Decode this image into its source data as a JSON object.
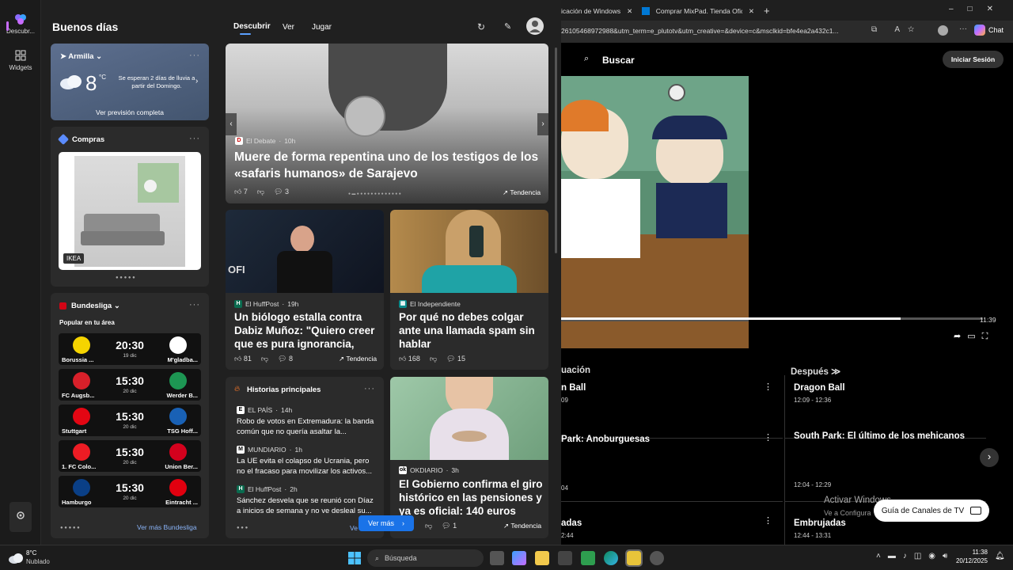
{
  "rail": {
    "discover_label": "Descubr...",
    "widgets_label": "Widgets"
  },
  "header": {
    "greeting": "Buenos días",
    "tabs": [
      "Descubrir",
      "Ver",
      "Jugar"
    ]
  },
  "weather": {
    "location": "Armilla",
    "temp": "8",
    "unit": "°C",
    "forecast_note": "Se esperan 2 días de lluvia a partir del Domingo.",
    "link": "Ver previsión completa"
  },
  "shopping": {
    "title": "Compras",
    "brand": "IKEA"
  },
  "bundesliga": {
    "title": "Bundesliga",
    "subtitle": "Popular en tu área",
    "matches": [
      {
        "home": "Borussia ...",
        "away": "M'gladba...",
        "time": "20:30",
        "date": "19 dic",
        "home_color": "#f5d400",
        "away_color": "#ffffff"
      },
      {
        "home": "FC Augsb...",
        "away": "Werder B...",
        "time": "15:30",
        "date": "20 dic",
        "home_color": "#d8202a",
        "away_color": "#1d9653"
      },
      {
        "home": "Stuttgart",
        "away": "TSG Hoff...",
        "time": "15:30",
        "date": "20 dic",
        "home_color": "#e30613",
        "away_color": "#1961b5"
      },
      {
        "home": "1. FC Colo...",
        "away": "Union Ber...",
        "time": "15:30",
        "date": "20 dic",
        "home_color": "#ed1c24",
        "away_color": "#d4011d"
      },
      {
        "home": "Hamburgo",
        "away": "Eintracht ...",
        "time": "15:30",
        "date": "20 dic",
        "home_color": "#0a3f86",
        "away_color": "#e1000f"
      }
    ],
    "more": "Ver más Bundesliga"
  },
  "hero": {
    "source": "El Debate",
    "age": "10h",
    "title": "Muere de forma repentina uno de los testigos de los «safaris humanos» de Sarajevo",
    "likes": "7",
    "comments": "3",
    "trend": "Tendencia"
  },
  "card_huff": {
    "source": "El HuffPost",
    "age": "19h",
    "title": "Un biólogo estalla contra Dabiz Muñoz: \"Quiero creer que es pura ignorancia, qu...",
    "likes": "81",
    "comments": "8",
    "trend": "Tendencia"
  },
  "card_indep": {
    "source": "El Independiente",
    "title": "Por qué no debes colgar ante una llamada spam sin hablar",
    "likes": "168",
    "comments": "15"
  },
  "top_stories": {
    "title": "Historias principales",
    "items": [
      {
        "source": "EL PAÍS",
        "age": "14h",
        "text": "Robo de votos en Extremadura: la banda común que no quería asaltar la..."
      },
      {
        "source": "MUNDIARIO",
        "age": "1h",
        "text": "La UE evita el colapso de Ucrania, pero no el fracaso para movilizar los activos..."
      },
      {
        "source": "El HuffPost",
        "age": "2h",
        "text": "Sánchez desvela que se reunió con Díaz a inicios de semana y no ve desleal su..."
      }
    ],
    "more_short": "Ve"
  },
  "card_okdiario": {
    "source": "OKDIARIO",
    "age": "3h",
    "title": "El Gobierno confirma el giro histórico en las pensiones y ya es oficial: 140 euros más...",
    "comments": "1",
    "trend": "Tendencia"
  },
  "see_more": "Ver más",
  "browser": {
    "tabs": [
      "icación de Windows",
      "Comprar MixPad. Tienda Oficial de"
    ],
    "url": "26105468972988&utm_term=e_plutotv&utm_creative=&device=c&msclkid=bfe4ea2a432c1...",
    "chat": "Chat",
    "search": "Buscar",
    "login": "Iniciar Sesión",
    "video_time": "11:39",
    "now_label": "uación",
    "next_label": "Después",
    "now_programs": [
      {
        "title": "n Ball",
        "time": "09"
      },
      {
        "title": "Park: Anoburguesas",
        "time": "04"
      },
      {
        "title": "adas",
        "time": "2:44"
      }
    ],
    "next_programs": [
      {
        "title": "Dragon Ball",
        "time": "12:09 - 12:36"
      },
      {
        "title": "South Park: El último de los mehicanos",
        "time": "12:04 - 12:29"
      },
      {
        "title": "Embrujadas",
        "time": "12:44 - 13:31"
      }
    ],
    "activate_title": "Activar Windows",
    "activate_sub": "Ve a Configura",
    "guide_button": "Guía de Canales de TV"
  },
  "taskbar": {
    "weather_temp": "8°C",
    "weather_desc": "Nublado",
    "search": "Búsqueda",
    "time": "11:38",
    "date": "20/12/2025"
  }
}
